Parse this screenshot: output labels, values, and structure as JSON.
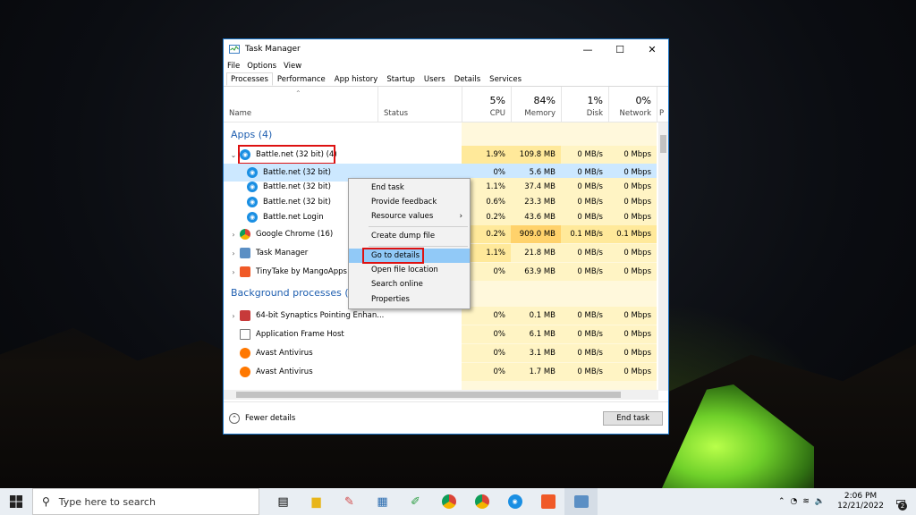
{
  "window": {
    "title": "Task Manager",
    "min": "—",
    "max": "☐",
    "close": "✕"
  },
  "menu": [
    "File",
    "Options",
    "View"
  ],
  "tabs": [
    "Processes",
    "Performance",
    "App history",
    "Startup",
    "Users",
    "Details",
    "Services"
  ],
  "columns": {
    "name": "Name",
    "status": "Status",
    "cpu_pct": "5%",
    "cpu": "CPU",
    "mem_pct": "84%",
    "mem": "Memory",
    "disk_pct": "1%",
    "disk": "Disk",
    "net_pct": "0%",
    "net": "Network",
    "power": "P"
  },
  "groups": {
    "apps": "Apps (4)",
    "background": "Background processes (6"
  },
  "rows": [
    {
      "name": "Battle.net (32 bit) (4)",
      "cpu": "1.9%",
      "mem": "109.8 MB",
      "disk": "0 MB/s",
      "net": "0 Mbps"
    },
    {
      "name": "Battle.net (32 bit)",
      "cpu": "0%",
      "mem": "5.6 MB",
      "disk": "0 MB/s",
      "net": "0 Mbps"
    },
    {
      "name": "Battle.net (32 bit)",
      "cpu": "1.1%",
      "mem": "37.4 MB",
      "disk": "0 MB/s",
      "net": "0 Mbps"
    },
    {
      "name": "Battle.net (32 bit)",
      "cpu": "0.6%",
      "mem": "23.3 MB",
      "disk": "0 MB/s",
      "net": "0 Mbps"
    },
    {
      "name": "Battle.net Login",
      "cpu": "0.2%",
      "mem": "43.6 MB",
      "disk": "0 MB/s",
      "net": "0 Mbps"
    },
    {
      "name": "Google Chrome (16)",
      "cpu": "0.2%",
      "mem": "909.0 MB",
      "disk": "0.1 MB/s",
      "net": "0.1 Mbps"
    },
    {
      "name": "Task Manager",
      "cpu": "1.1%",
      "mem": "21.8 MB",
      "disk": "0 MB/s",
      "net": "0 Mbps"
    },
    {
      "name": "TinyTake by MangoApps (32 bit)",
      "cpu": "0%",
      "mem": "63.9 MB",
      "disk": "0 MB/s",
      "net": "0 Mbps"
    },
    {
      "name": "64-bit Synaptics Pointing Enhan...",
      "cpu": "0%",
      "mem": "0.1 MB",
      "disk": "0 MB/s",
      "net": "0 Mbps"
    },
    {
      "name": "Application Frame Host",
      "cpu": "0%",
      "mem": "6.1 MB",
      "disk": "0 MB/s",
      "net": "0 Mbps"
    },
    {
      "name": "Avast Antivirus",
      "cpu": "0%",
      "mem": "3.1 MB",
      "disk": "0 MB/s",
      "net": "0 Mbps"
    },
    {
      "name": "Avast Antivirus",
      "cpu": "0%",
      "mem": "1.7 MB",
      "disk": "0 MB/s",
      "net": "0 Mbps"
    }
  ],
  "context_menu": {
    "items": [
      "End task",
      "Provide feedback",
      "Resource values",
      "Create dump file",
      "Go to details",
      "Open file location",
      "Search online",
      "Properties"
    ],
    "submenu_arrow": "›"
  },
  "footer": {
    "fewer_details": "Fewer details",
    "end_task": "End task"
  },
  "taskbar": {
    "search_placeholder": "Type here to search",
    "time": "2:06 PM",
    "date": "12/21/2022",
    "notifications": "2"
  }
}
